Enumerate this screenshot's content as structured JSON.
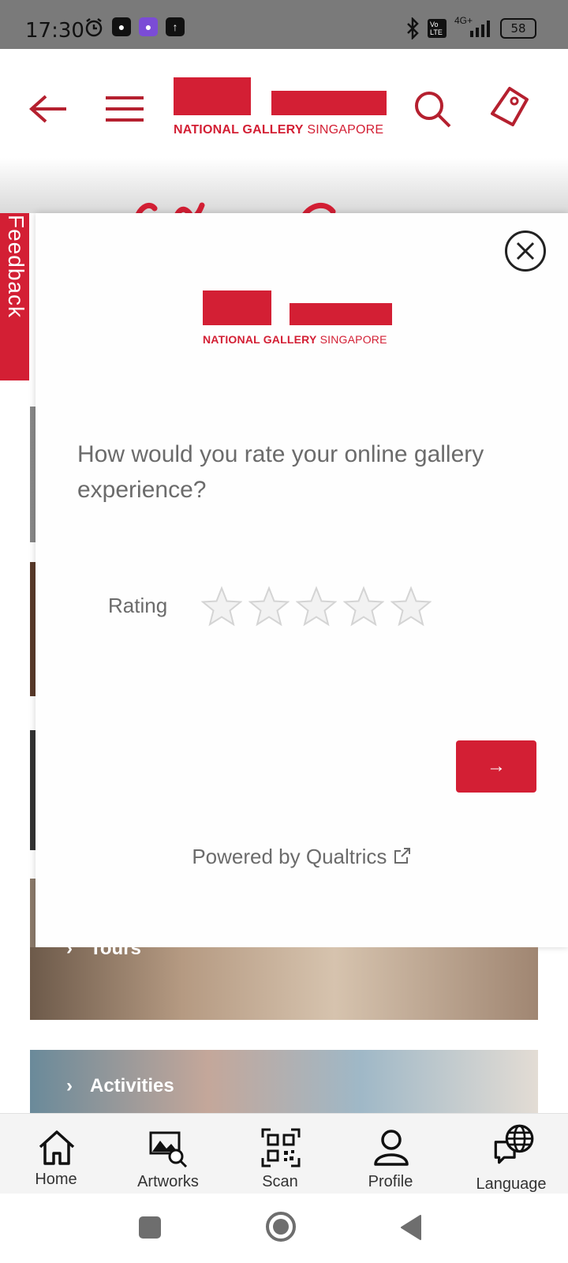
{
  "status_bar": {
    "time": "17:30",
    "battery": "58",
    "network": "4G+",
    "volte": "Vo LTE"
  },
  "header": {
    "logo_bold": "NATIONAL GALLERY",
    "logo_light": " SINGAPORE",
    "brand_color": "#d31f34"
  },
  "feedback_tab": {
    "label": "Feedback"
  },
  "background_cards": [
    {
      "label": "Tours"
    },
    {
      "label": "Activities"
    }
  ],
  "survey": {
    "logo_bold": "NATIONAL GALLERY",
    "logo_light": " SINGAPORE",
    "question": "How would you rate your online gallery experience?",
    "rating_label": "Rating",
    "stars_total": 5,
    "stars_selected": 0,
    "next_label": "→",
    "powered_by": "Powered by Qualtrics"
  },
  "bottom_nav": {
    "items": [
      {
        "label": "Home",
        "icon": "home-icon"
      },
      {
        "label": "Artworks",
        "icon": "artworks-icon"
      },
      {
        "label": "Scan",
        "icon": "qr-scan-icon"
      },
      {
        "label": "Profile",
        "icon": "profile-icon"
      },
      {
        "label": "Language",
        "icon": "language-icon"
      }
    ]
  }
}
